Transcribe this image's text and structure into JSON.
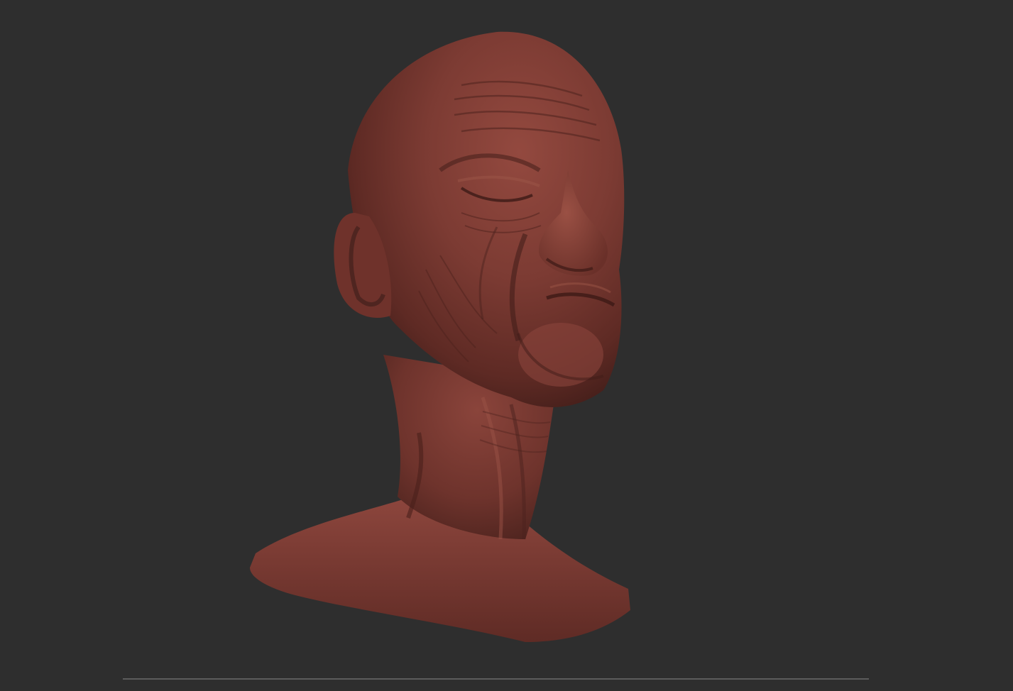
{
  "viewport": {
    "background_color": "#2e2e2e",
    "model_material_color": "#7a3a33",
    "model_description_icon": "sculpted-head-bust-icon"
  },
  "timeline": {
    "track_color": "#5c5c5c"
  }
}
